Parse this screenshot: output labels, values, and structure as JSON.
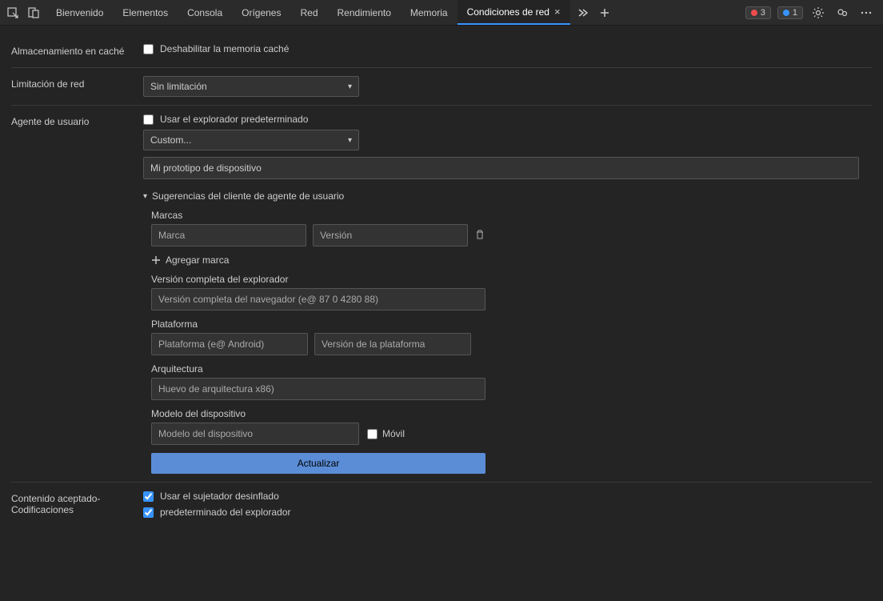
{
  "toolbar": {
    "tabs": {
      "welcome": "Bienvenido",
      "elements": "Elementos",
      "console": "Consola",
      "sources": "Orígenes",
      "network": "Red",
      "performance": "Rendimiento",
      "memory": "Memoria",
      "network_conditions": "Condiciones de red"
    },
    "errors": "3",
    "info": "1"
  },
  "caching": {
    "label": "Almacenamiento en caché",
    "disable_cache": "Deshabilitar la memoria caché"
  },
  "throttling": {
    "label": "Limitación de red",
    "selected": "Sin limitación"
  },
  "user_agent": {
    "label": "Agente de usuario",
    "use_default": "Usar el explorador predeterminado",
    "preset": "Custom...",
    "custom_value": "Mi prototipo de dispositivo",
    "hints_header": "Sugerencias del cliente de agente de usuario",
    "brands_label": "Marcas",
    "brand_placeholder": "Marca",
    "version_placeholder": "Versión",
    "add_brand": "Agregar marca",
    "full_version_label": "Versión completa del explorador",
    "full_version_placeholder": "Versión completa del navegador (e@ 87 0 4280 88)",
    "platform_label": "Plataforma",
    "platform_placeholder": "Plataforma (e@ Android)",
    "platform_version_placeholder": "Versión de la plataforma",
    "architecture_label": "Arquitectura",
    "architecture_placeholder": "Huevo de arquitectura x86)",
    "device_model_label": "Modelo del dispositivo",
    "device_model_placeholder": "Modelo del dispositivo",
    "mobile_label": "Móvil",
    "update_button": "Actualizar"
  },
  "encodings": {
    "label_line1": "Contenido aceptado-",
    "label_line2": "Codificaciones",
    "use_deflate": "Usar el sujetador desinflado",
    "browser_default": "predeterminado del explorador"
  }
}
